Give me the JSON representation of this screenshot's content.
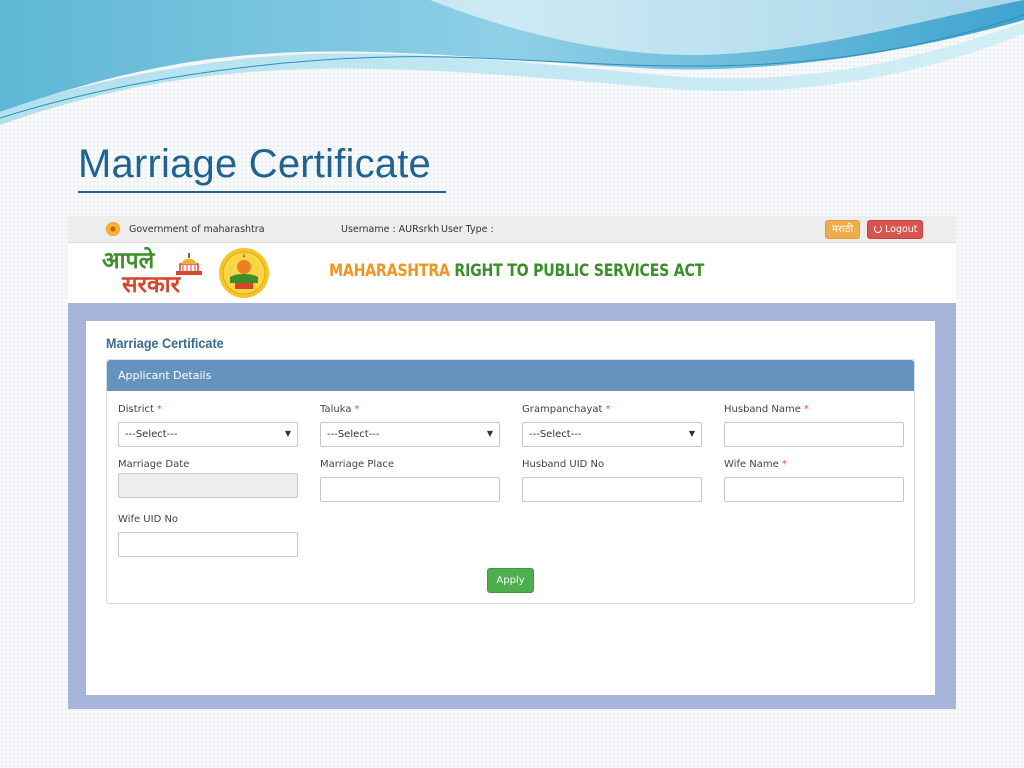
{
  "slide": {
    "title": "Marriage Certificate"
  },
  "topbar": {
    "gov_label": "Government of maharashtra",
    "username_label": "Username : AURsrkh",
    "usertype_label": "User Type :",
    "lang_button": "मराठी",
    "logout_button": "Logout"
  },
  "banner": {
    "logo_line1": "आपले",
    "logo_line2": "सरकार",
    "title_part1": "MAHARASHTRA",
    "title_part2": "RIGHT TO PUBLIC SERVICES ACT"
  },
  "form": {
    "heading": "Marriage Certificate",
    "panel_title": "Applicant Details",
    "fields": {
      "district": {
        "label": "District",
        "value": "---Select---",
        "required": "*"
      },
      "taluka": {
        "label": "Taluka",
        "value": "---Select---",
        "required": "*"
      },
      "grampanchayat": {
        "label": "Grampanchayat",
        "value": "---Select---",
        "required": "*"
      },
      "husband_name": {
        "label": "Husband Name",
        "value": "",
        "required": "*"
      },
      "marriage_date": {
        "label": "Marriage Date",
        "value": ""
      },
      "marriage_place": {
        "label": "Marriage Place",
        "value": ""
      },
      "husband_uid": {
        "label": "Husband UID No",
        "value": ""
      },
      "wife_name": {
        "label": "Wife Name",
        "value": "",
        "required": "*"
      },
      "wife_uid": {
        "label": "Wife UID No",
        "value": ""
      }
    },
    "apply_button": "Apply"
  },
  "colors": {
    "title": "#1f6391",
    "panel_header": "#6593bd",
    "frame_bg": "#a7b4dc",
    "apply": "#4cae4c",
    "logout": "#d9534f",
    "lang": "#f0ad4e"
  }
}
